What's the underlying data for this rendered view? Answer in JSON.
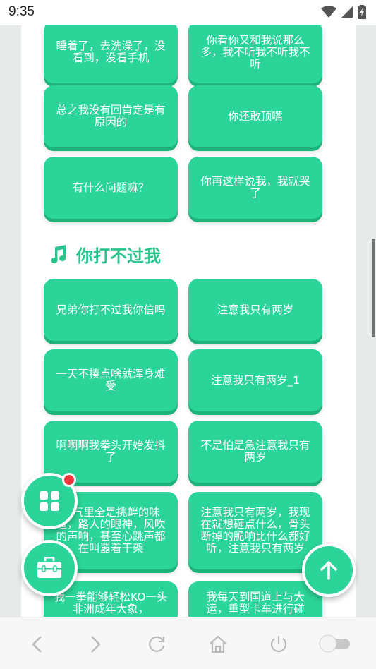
{
  "status_bar": {
    "time": "9:35"
  },
  "section": {
    "title": "你打不过我"
  },
  "buttons_top": [
    {
      "label": "睡着了，去洗澡了，没看到，没看手机"
    },
    {
      "label": "你看你又和我说那么多，我不听我不听我不听"
    },
    {
      "label": "总之我没有回肯定是有原因的"
    },
    {
      "label": "你还敢顶嘴"
    },
    {
      "label": "有什么问题嘛？"
    },
    {
      "label": "你再这样说我，我就哭了"
    }
  ],
  "buttons_section": [
    {
      "label": "兄弟你打不过我你信吗"
    },
    {
      "label": "注意我只有两岁"
    },
    {
      "label": "一天不揍点啥就浑身难受"
    },
    {
      "label": "注意我只有两岁_1"
    },
    {
      "label": "啊啊啊我拳头开始发抖了"
    },
    {
      "label": "不是怕是急注意我只有两岁"
    },
    {
      "label": "空气里全是挑衅的味道，路人的眼神，风吹的声响，甚至心跳声都在叫嚣着干架"
    },
    {
      "label": "注意我只有两岁，我现在就想砸点什么，骨头断掉的脆响比什么都好听，注意我只有两岁"
    },
    {
      "label": "我一拳能够轻松KO一头非洲成年大象，"
    },
    {
      "label": "我每天到国道上与大运，重型卡车进行碰"
    }
  ],
  "colors": {
    "accent": "#2bd498",
    "accent_dark": "#1fb37c",
    "title": "#2bc48c",
    "badge": "#f0363e"
  },
  "icons": {
    "fab_top": "grid-icon",
    "fab_bottom": "toolbox-icon",
    "fab_right": "arrow-up-icon",
    "section": "music-note-icon"
  },
  "nav_bar": [
    "back-icon",
    "forward-icon",
    "refresh-icon",
    "home-icon",
    "power-icon",
    "toggle-switch"
  ]
}
